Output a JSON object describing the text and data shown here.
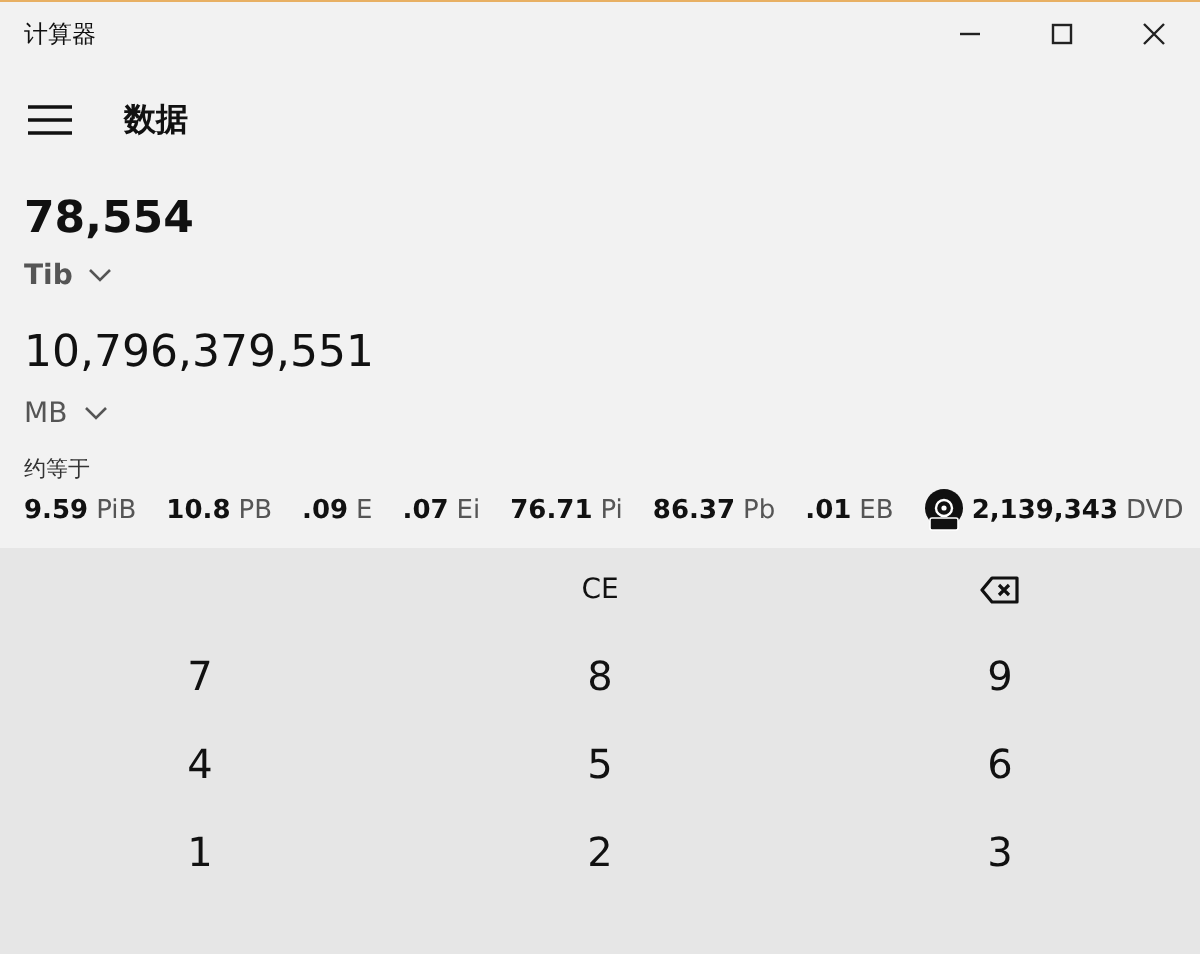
{
  "window": {
    "title": "计算器"
  },
  "header": {
    "title": "数据"
  },
  "from": {
    "value": "78,554",
    "unit": "Tib"
  },
  "to": {
    "value": "10,796,379,551",
    "unit": "MB"
  },
  "approx": {
    "label": "约等于",
    "items": [
      {
        "kind": "plain",
        "value": "9.59",
        "unit": "PiB"
      },
      {
        "kind": "plain",
        "value": "10.8",
        "unit": "PB"
      },
      {
        "kind": "plain",
        "value": ".09",
        "unit": "E"
      },
      {
        "kind": "plain",
        "value": ".07",
        "unit": "Ei"
      },
      {
        "kind": "plain",
        "value": "76.71",
        "unit": "Pi"
      },
      {
        "kind": "plain",
        "value": "86.37",
        "unit": "Pb"
      },
      {
        "kind": "plain",
        "value": ".01",
        "unit": "EB"
      },
      {
        "kind": "disc",
        "value": "2,139,343",
        "unit": "DVD"
      }
    ]
  },
  "keys": [
    {
      "kind": "blank"
    },
    {
      "kind": "clear",
      "label": "CE"
    },
    {
      "kind": "backspace"
    },
    {
      "kind": "digit",
      "label": "7"
    },
    {
      "kind": "digit",
      "label": "8"
    },
    {
      "kind": "digit",
      "label": "9"
    },
    {
      "kind": "digit",
      "label": "4"
    },
    {
      "kind": "digit",
      "label": "5"
    },
    {
      "kind": "digit",
      "label": "6"
    },
    {
      "kind": "digit",
      "label": "1"
    },
    {
      "kind": "digit",
      "label": "2"
    },
    {
      "kind": "digit",
      "label": "3"
    }
  ]
}
